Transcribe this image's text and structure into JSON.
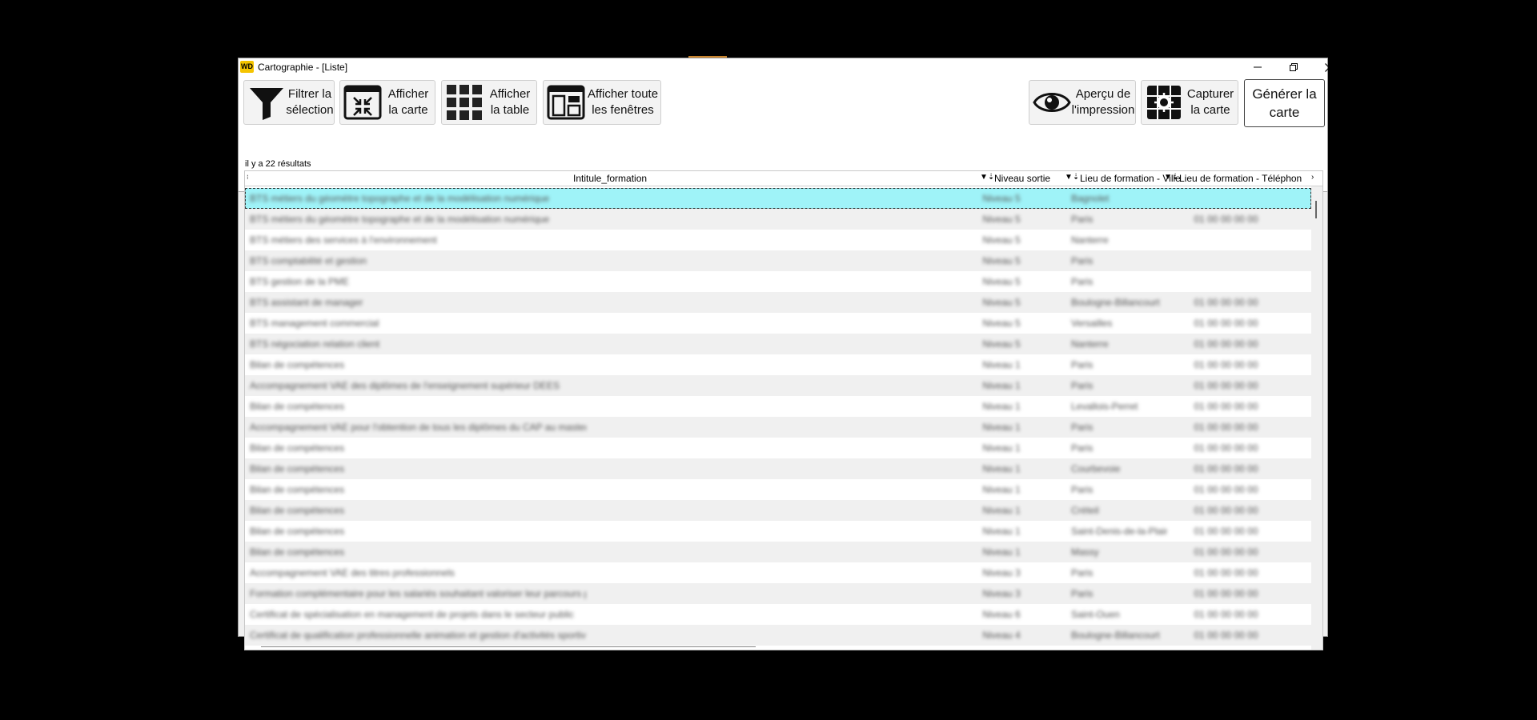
{
  "window": {
    "title": "Cartographie - [Liste]",
    "app_icon_text": "WD"
  },
  "toolbar": {
    "buttons": [
      {
        "label": "Filtrer la\nsélection",
        "icon": "funnel-icon"
      },
      {
        "label": "Afficher\nla carte",
        "icon": "collapse-arrows-icon"
      },
      {
        "label": "Afficher\nla table",
        "icon": "grid-icon"
      },
      {
        "label": "Afficher toute\nles fenêtres",
        "icon": "windows-icon"
      },
      {
        "label": "Aperçu de\nl'impression",
        "icon": "eye-icon"
      },
      {
        "label": "Capturer\nla carte",
        "icon": "capture-map-icon"
      },
      {
        "label": "Générer la\ncarte"
      }
    ]
  },
  "results": {
    "count_text": "il y a 22 résultats"
  },
  "table": {
    "columns": [
      "Intitule_formation",
      "Niveau sortie",
      "Lieu de formation - Ville",
      "Lieu de formation - Téléphon"
    ],
    "rows": [
      [
        "BTS métiers du géomètre topographe et de la modélisation numérique",
        "Niveau 5",
        "Bagnolet",
        ""
      ],
      [
        "BTS métiers du géomètre topographe et de la modélisation numérique",
        "Niveau 5",
        "Paris",
        "01 00 00 00 00"
      ],
      [
        "BTS métiers des services à l'environnement",
        "Niveau 5",
        "Nanterre",
        ""
      ],
      [
        "BTS comptabilité et gestion",
        "Niveau 5",
        "Paris",
        ""
      ],
      [
        "BTS gestion de la PME",
        "Niveau 5",
        "Paris",
        ""
      ],
      [
        "BTS assistant de manager",
        "Niveau 5",
        "Boulogne-Billancourt",
        "01 00 00 00 00"
      ],
      [
        "BTS management commercial",
        "Niveau 5",
        "Versailles",
        "01 00 00 00 00"
      ],
      [
        "BTS négociation relation client",
        "Niveau 5",
        "Nanterre",
        "01 00 00 00 00"
      ],
      [
        "Bilan de compétences",
        "Niveau 1",
        "Paris",
        "01 00 00 00 00"
      ],
      [
        "Accompagnement VAE des diplômes de l'enseignement supérieur DEES",
        "Niveau 1",
        "Paris",
        "01 00 00 00 00"
      ],
      [
        "Bilan de compétences",
        "Niveau 1",
        "Levallois-Perret",
        "01 00 00 00 00"
      ],
      [
        "Accompagnement VAE pour l'obtention de tous les diplômes du CAP au master",
        "Niveau 1",
        "Paris",
        "01 00 00 00 00"
      ],
      [
        "Bilan de compétences",
        "Niveau 1",
        "Paris",
        "01 00 00 00 00"
      ],
      [
        "Bilan de compétences",
        "Niveau 1",
        "Courbevoie",
        "01 00 00 00 00"
      ],
      [
        "Bilan de compétences",
        "Niveau 1",
        "Paris",
        "01 00 00 00 00"
      ],
      [
        "Bilan de compétences",
        "Niveau 1",
        "Créteil",
        "01 00 00 00 00"
      ],
      [
        "Bilan de compétences",
        "Niveau 1",
        "Saint-Denis-de-la-Plaine",
        "01 00 00 00 00"
      ],
      [
        "Bilan de compétences",
        "Niveau 1",
        "Massy",
        "01 00 00 00 00"
      ],
      [
        "Accompagnement VAE des titres professionnels",
        "Niveau 3",
        "Paris",
        "01 00 00 00 00"
      ],
      [
        "Formation complémentaire pour les salariés souhaitant valoriser leur parcours professionnel",
        "Niveau 3",
        "Paris",
        "01 00 00 00 00"
      ],
      [
        "Certificat de spécialisation en management de projets dans le secteur public",
        "Niveau 6",
        "Saint-Ouen",
        "01 00 00 00 00"
      ],
      [
        "Certificat de qualification professionnelle animation et gestion d'activités sportives et de loisirs",
        "Niveau 4",
        "Boulogne-Billancourt",
        "01 00 00 00 00"
      ]
    ]
  }
}
